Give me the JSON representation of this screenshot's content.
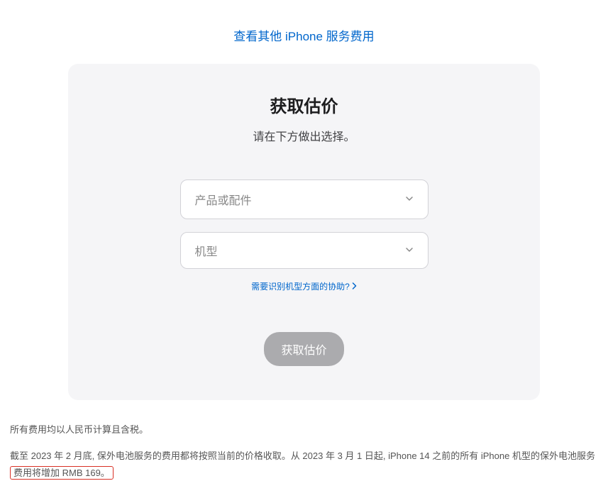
{
  "topLink": "查看其他 iPhone 服务费用",
  "card": {
    "title": "获取估价",
    "subtitle": "请在下方做出选择。",
    "dropdown1": "产品或配件",
    "dropdown2": "机型",
    "helpLink": "需要识别机型方面的协助?",
    "submitLabel": "获取估价"
  },
  "footer": {
    "line1": "所有费用均以人民币计算且含税。",
    "line2_pre": "截至 2023 年 2 月底, 保外电池服务的费用都将按照当前的价格收取。从 2023 年 3 月 1 日起, iPhone 14 之前的所有 iPhone 机型的保外电池服务",
    "line2_highlight": "费用将增加 RMB 169。"
  }
}
